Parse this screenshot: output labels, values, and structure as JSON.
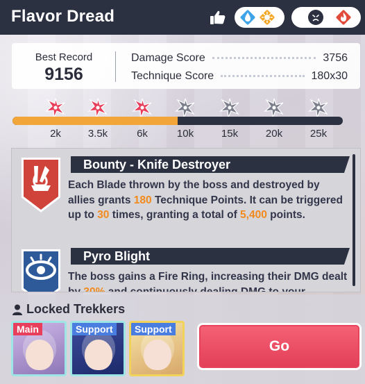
{
  "title": "Flavor Dread",
  "header_icons": {
    "like": "thumbs-up-icon",
    "weak_elements": [
      "water-element-icon",
      "light-element-icon"
    ],
    "resist_elements": [
      "fire-element-icon"
    ],
    "resist_marker": "frown-face-icon"
  },
  "record": {
    "best_label": "Best Record",
    "best_value": "9156",
    "damage_label": "Damage Score",
    "damage_value": "3756",
    "technique_label": "Technique Score",
    "technique_value": "180x30"
  },
  "progress": {
    "fill_fraction": 0.5,
    "ticks": [
      "2k",
      "3.5k",
      "6k",
      "10k",
      "15k",
      "20k",
      "25k"
    ],
    "achieved_count": 3,
    "colors": {
      "achieved": "#e8405c",
      "locked": "#7b7f8c",
      "fill": "#f2a63a",
      "track": "#2c3142"
    }
  },
  "effects": [
    {
      "name": "Bounty - Knife Destroyer",
      "icon": "knife-destroyer-icon",
      "desc_parts": [
        {
          "t": "Each Blade thrown by the boss and destroyed by allies grants ",
          "hl": false
        },
        {
          "t": "180",
          "hl": true
        },
        {
          "t": " Technique Points. It can be triggered up to ",
          "hl": false
        },
        {
          "t": "30",
          "hl": true
        },
        {
          "t": " times, granting a total of ",
          "hl": false
        },
        {
          "t": "5,400",
          "hl": true
        },
        {
          "t": " points.",
          "hl": false
        }
      ]
    },
    {
      "name": "Pyro Blight",
      "icon": "pyro-blight-icon",
      "desc_parts": [
        {
          "t": "The boss gains a Fire Ring, increasing their DMG dealt by ",
          "hl": false
        },
        {
          "t": "30%",
          "hl": true
        },
        {
          "t": " and continuously dealing DMG to your",
          "hl": false
        }
      ]
    }
  ],
  "locked": {
    "title": "Locked Trekkers",
    "trekkers": [
      {
        "tag": "Main",
        "tag_color": "#e8405c",
        "border": "#9ee6e6",
        "bg": [
          "#cdb7e6",
          "#8e77b7"
        ]
      },
      {
        "tag": "Support",
        "tag_color": "#4a7de0",
        "border": "#9ee6e6",
        "bg": [
          "#3d4a9c",
          "#1c2a6a"
        ]
      },
      {
        "tag": "Support",
        "tag_color": "#4a7de0",
        "border": "#f2d35a",
        "bg": [
          "#f6e4a6",
          "#d8a86a"
        ]
      }
    ]
  },
  "go_label": "Go"
}
